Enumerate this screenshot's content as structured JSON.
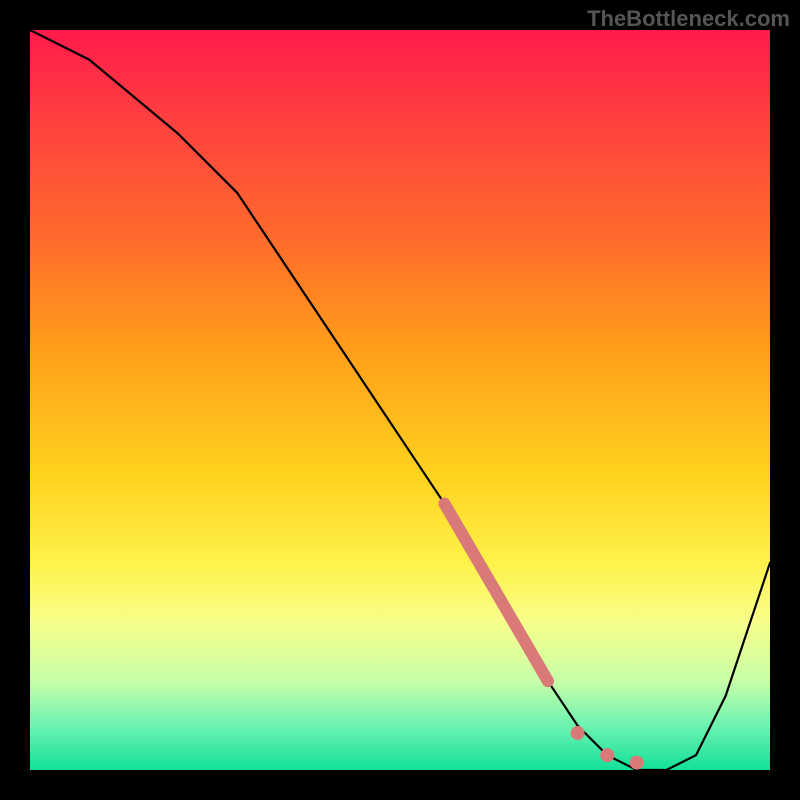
{
  "watermark": "TheBottleneck.com",
  "chart_data": {
    "type": "line",
    "title": "",
    "xlabel": "",
    "ylabel": "",
    "xlim": [
      0,
      100
    ],
    "ylim": [
      0,
      100
    ],
    "grid": false,
    "legend": false,
    "curve": {
      "x": [
        0,
        8,
        20,
        28,
        36,
        44,
        52,
        60,
        66,
        70,
        74,
        78,
        82,
        86,
        90,
        94,
        100
      ],
      "y": [
        100,
        96,
        86,
        78,
        66,
        54,
        42,
        30,
        20,
        12,
        6,
        2,
        0,
        0,
        2,
        10,
        28
      ]
    },
    "highlight": {
      "color": "#d97a78",
      "continuous_segment": {
        "x": [
          56,
          70
        ],
        "y": [
          36,
          12
        ]
      },
      "dots": [
        {
          "x": 74,
          "y": 5
        },
        {
          "x": 78,
          "y": 2
        },
        {
          "x": 82,
          "y": 1
        }
      ]
    }
  }
}
